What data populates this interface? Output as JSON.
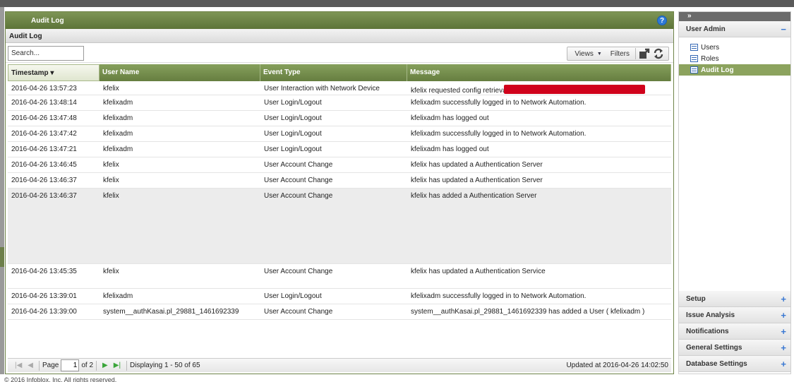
{
  "panel": {
    "title": "Audit Log",
    "subtitle": "Audit Log",
    "help": "?"
  },
  "toolbar": {
    "search_value": "Search...",
    "views_label": "Views",
    "filters_label": "Filters"
  },
  "columns": [
    "Timestamp",
    "User Name",
    "Event Type",
    "Message"
  ],
  "rows": [
    {
      "ts": "2016-04-26 13:57:23",
      "user": "kfelix",
      "event": "User Interaction with Network Device",
      "msg": "kfelix requested config retrieval"
    },
    {
      "ts": "2016-04-26 13:48:14",
      "user": "kfelixadm",
      "event": "User Login/Logout",
      "msg": "kfelixadm successfully logged in to Network Automation."
    },
    {
      "ts": "2016-04-26 13:47:48",
      "user": "kfelixadm",
      "event": "User Login/Logout",
      "msg": "kfelixadm has logged out"
    },
    {
      "ts": "2016-04-26 13:47:42",
      "user": "kfelixadm",
      "event": "User Login/Logout",
      "msg": "kfelixadm successfully logged in to Network Automation."
    },
    {
      "ts": "2016-04-26 13:47:21",
      "user": "kfelixadm",
      "event": "User Login/Logout",
      "msg": "kfelixadm has logged out"
    },
    {
      "ts": "2016-04-26 13:46:45",
      "user": "kfelix",
      "event": "User Account Change",
      "msg": "kfelix has updated a Authentication Server"
    },
    {
      "ts": "2016-04-26 13:46:37",
      "user": "kfelix",
      "event": "User Account Change",
      "msg": "kfelix has updated a Authentication Server"
    },
    {
      "ts": "2016-04-26 13:46:37",
      "user": "kfelix",
      "event": "User Account Change",
      "msg": "kfelix has added a Authentication Server"
    },
    {
      "ts": "2016-04-26 13:45:35",
      "user": "kfelix",
      "event": "User Account Change",
      "msg": "kfelix has updated a Authentication Service"
    },
    {
      "ts": "2016-04-26 13:39:01",
      "user": "kfelixadm",
      "event": "User Login/Logout",
      "msg": "kfelixadm successfully logged in to Network Automation."
    },
    {
      "ts": "2016-04-26 13:39:00",
      "user": "system__authKasai.pl_29881_1461692339",
      "event": "User Account Change",
      "msg": "system__authKasai.pl_29881_1461692339 has added a User ( kfelixadm )"
    }
  ],
  "pager": {
    "page_label": "Page",
    "page_value": "1",
    "of_label": "of 2",
    "displaying": "Displaying 1 - 50 of 65",
    "updated": "Updated at 2016-04-26 14:02:50"
  },
  "footer": "© 2016 Infoblox, Inc. All rights reserved.",
  "side": {
    "collapse": "»",
    "user_admin": "User Admin",
    "items": [
      "Users",
      "Roles",
      "Audit Log"
    ],
    "sections": [
      "Setup",
      "Issue Analysis",
      "Notifications",
      "General Settings",
      "Database Settings"
    ]
  },
  "colors": {
    "header_green": "#667e40",
    "active_green": "#8ca35e",
    "redaction": "#d0021b"
  }
}
